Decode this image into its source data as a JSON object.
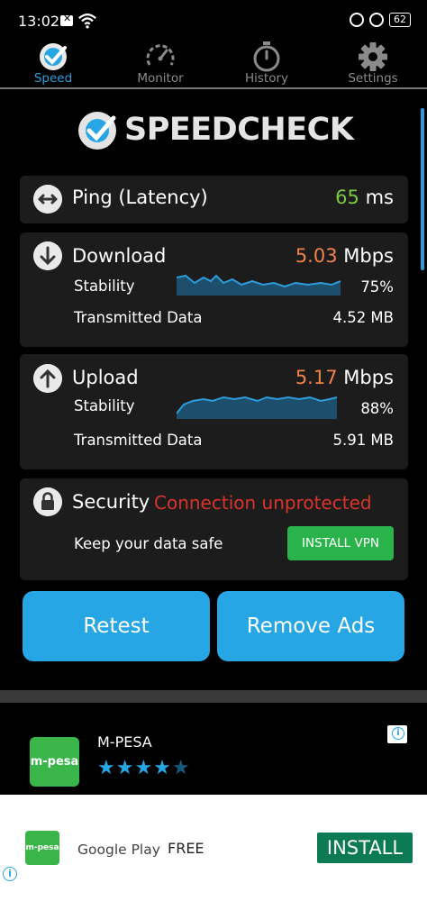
{
  "status_bar": {
    "time": "13:02",
    "battery": "62"
  },
  "nav": {
    "tabs": [
      {
        "label": "Speed",
        "active": true
      },
      {
        "label": "Monitor",
        "active": false
      },
      {
        "label": "History",
        "active": false
      },
      {
        "label": "Settings",
        "active": false
      }
    ]
  },
  "logo": {
    "text": "SPEEDCHECK"
  },
  "ping": {
    "title": "Ping (Latency)",
    "value": "65",
    "unit": "ms"
  },
  "download": {
    "title": "Download",
    "value": "5.03",
    "unit": "Mbps",
    "stability_label": "Stability",
    "stability_value": "75%",
    "stability_level": 0.75,
    "data_label": "Transmitted Data",
    "data_value": "4.52 MB"
  },
  "upload": {
    "title": "Upload",
    "value": "5.17",
    "unit": "Mbps",
    "stability_label": "Stability",
    "stability_value": "88%",
    "stability_level": 0.88,
    "data_label": "Transmitted Data",
    "data_value": "5.91 MB"
  },
  "security": {
    "title": "Security",
    "status": "Connection unprotected",
    "message": "Keep your data safe",
    "button": "INSTALL VPN"
  },
  "actions": {
    "retest": "Retest",
    "remove_ads": "Remove Ads"
  },
  "ad": {
    "app_name": "M-PESA",
    "icon_text": "m-pesa",
    "rating": 4.5
  },
  "banner": {
    "icon_text": "m-pesa",
    "store": "Google Play",
    "price": "FREE",
    "install": "INSTALL"
  },
  "colors": {
    "accent": "#27a6e5",
    "green": "#7ac943",
    "orange": "#f0824a",
    "red": "#d9342b",
    "install_green": "#29b34a"
  }
}
